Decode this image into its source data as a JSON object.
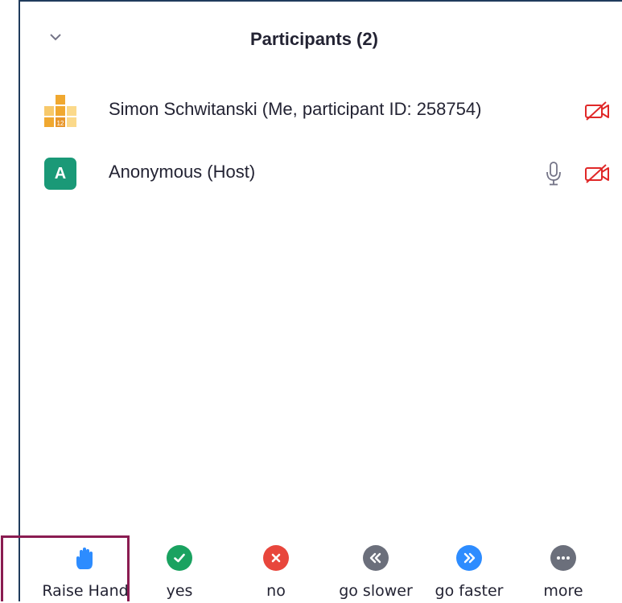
{
  "header": {
    "title": "Participants (2)",
    "collapse_icon": "chevron-down-icon"
  },
  "participants": [
    {
      "name": "Simon Schwitanski (Me, participant ID: 258754)",
      "avatar": "image",
      "avatar_badge": "12",
      "mic_shown": false,
      "video": "off"
    },
    {
      "name": "Anonymous (Host)",
      "avatar": "letter",
      "avatar_letter": "A",
      "mic_shown": true,
      "video": "off"
    }
  ],
  "toolbar": {
    "raise_hand": "Raise Hand",
    "yes": "yes",
    "no": "no",
    "go_slower": "go slower",
    "go_faster": "go faster",
    "more": "more"
  },
  "colors": {
    "border": "#1f3b5c",
    "highlight": "#8a1c51",
    "avatar_green": "#1a9977",
    "video_off_red": "#e02828",
    "yes_green": "#1aa260",
    "no_red": "#e8463c",
    "slower_gray": "#6b6f7b",
    "faster_blue": "#2d8cff",
    "more_gray": "#6b6f7b",
    "hand_blue": "#2d8cff"
  }
}
